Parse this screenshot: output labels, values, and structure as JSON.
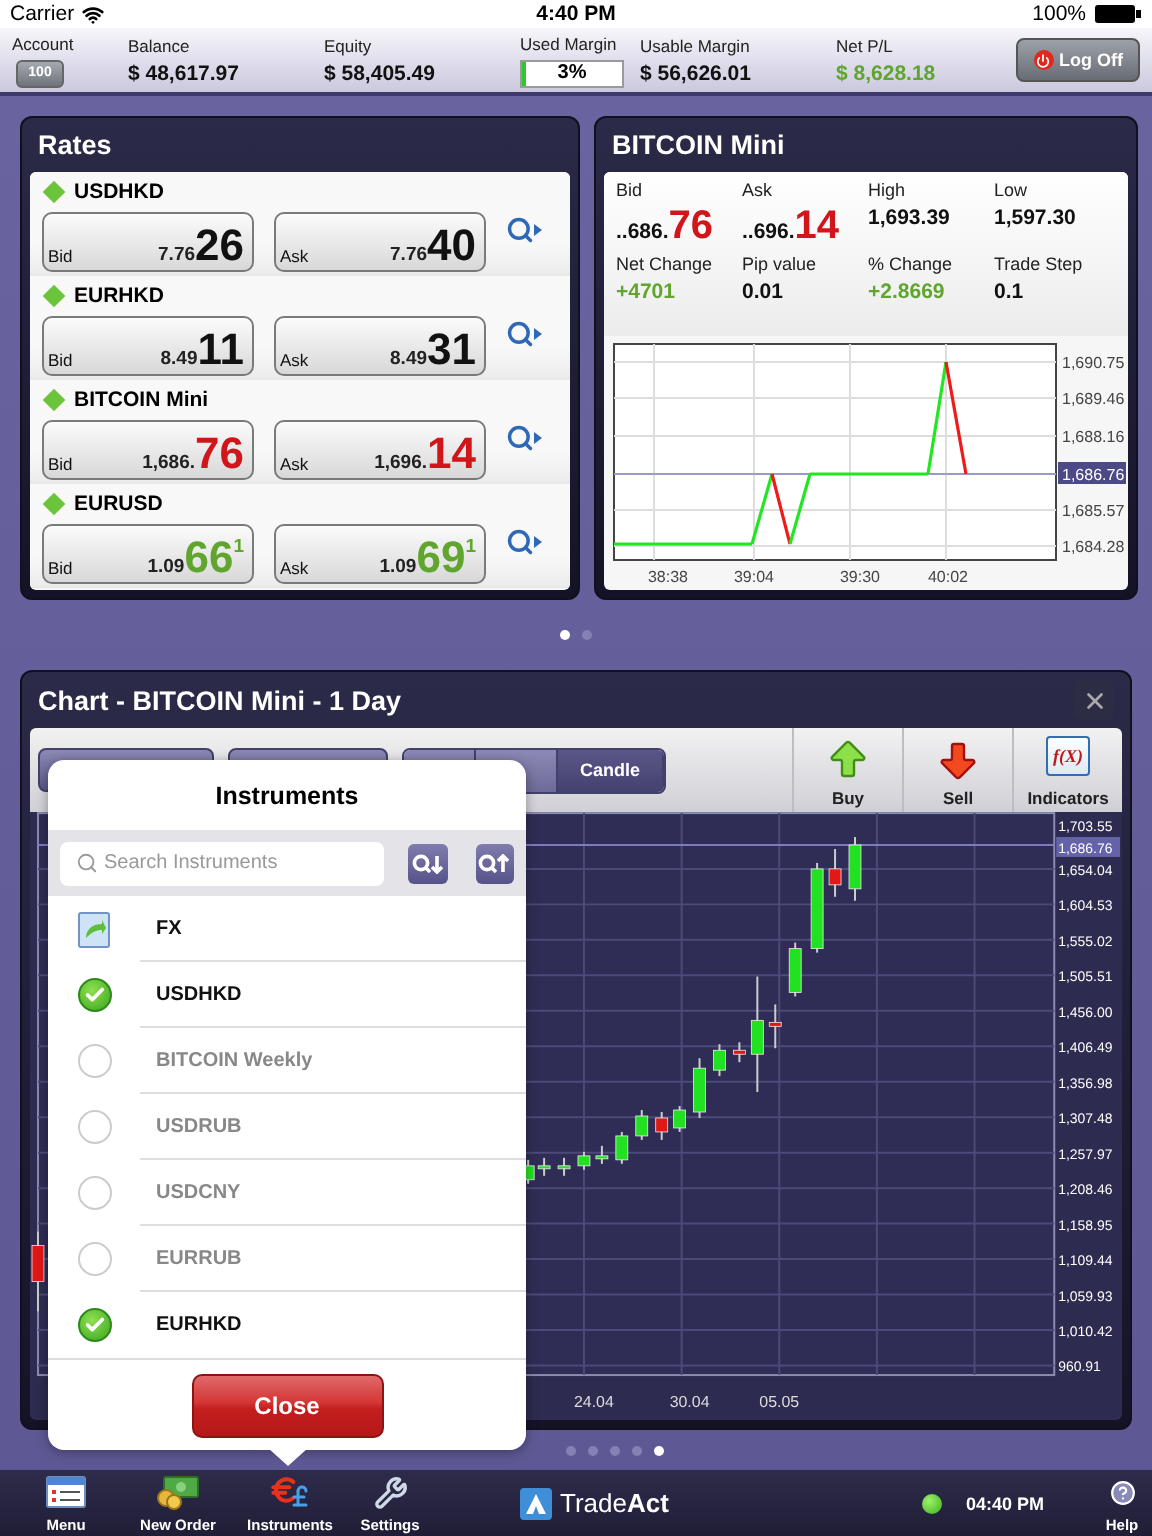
{
  "status_bar": {
    "carrier": "Carrier",
    "time": "4:40 PM",
    "battery": "100%"
  },
  "account_bar": {
    "account": {
      "label": "Account",
      "value": "100"
    },
    "fields": [
      {
        "label": "Balance",
        "value": "$ 48,617.97",
        "kind": "text",
        "color": "#111111"
      },
      {
        "label": "Equity",
        "value": "$ 58,405.49",
        "kind": "text",
        "color": "#111111"
      },
      {
        "label": "Used Margin",
        "value": "3%",
        "kind": "meter",
        "level": 0.03
      },
      {
        "label": "Usable Margin",
        "value": "$ 56,626.01",
        "kind": "text",
        "color": "#111111"
      },
      {
        "label": "Net P/L",
        "value": "$ 8,628.18",
        "kind": "text",
        "color": "#5fa52e"
      }
    ],
    "log_off": "Log Off"
  },
  "rates": {
    "title": "Rates",
    "rows": [
      {
        "name": "USDHKD",
        "quotes": [
          {
            "label": "Bid",
            "prefix": "7.76",
            "big": "26",
            "color": "#111111"
          },
          {
            "label": "Ask",
            "prefix": "7.76",
            "big": "40",
            "color": "#111111"
          }
        ]
      },
      {
        "name": "EURHKD",
        "quotes": [
          {
            "label": "Bid",
            "prefix": "8.49",
            "big": "11",
            "color": "#111111"
          },
          {
            "label": "Ask",
            "prefix": "8.49",
            "big": "31",
            "color": "#111111"
          }
        ]
      },
      {
        "name": "BITCOIN Mini",
        "quotes": [
          {
            "label": "Bid",
            "prefix": "1,686.",
            "big": "76",
            "color": "#d0161b"
          },
          {
            "label": "Ask",
            "prefix": "1,696.",
            "big": "14",
            "color": "#d0161b"
          }
        ]
      },
      {
        "name": "EURUSD",
        "quotes": [
          {
            "label": "Bid",
            "prefix": "1.09",
            "big": "66",
            "suffix": "1",
            "color": "#5fa52e"
          },
          {
            "label": "Ask",
            "prefix": "1.09",
            "big": "69",
            "suffix": "1",
            "color": "#5fa52e"
          }
        ]
      }
    ]
  },
  "details": {
    "title": "BITCOIN Mini",
    "stats": [
      {
        "label": "Bid",
        "value": "..686.",
        "big": "76",
        "color": "#d0161b"
      },
      {
        "label": "Ask",
        "value": "..696.",
        "big": "14",
        "color": "#d0161b"
      },
      {
        "label": "High",
        "value": "1,693.39",
        "color": "#111111"
      },
      {
        "label": "Low",
        "value": "1,597.30",
        "color": "#111111"
      },
      {
        "label": "Net Change",
        "value": "+4701",
        "color": "#5fa52e"
      },
      {
        "label": "Pip value",
        "value": "0.01",
        "color": "#111111"
      },
      {
        "label": "% Change",
        "value": "+2.8669",
        "color": "#5fa52e"
      },
      {
        "label": "Trade Step",
        "value": "0.1",
        "color": "#111111"
      }
    ],
    "tick_chart": {
      "y_labels": [
        {
          "text": "1,690.75",
          "current": false
        },
        {
          "text": "1,689.46",
          "current": false
        },
        {
          "text": "1,688.16",
          "current": false
        },
        {
          "text": "1,686.76",
          "current": true
        },
        {
          "text": "1,685.57",
          "current": false
        },
        {
          "text": "1,684.28",
          "current": false
        }
      ],
      "x_labels": [
        "38:38",
        "39:04",
        "39:30",
        "40:02"
      ]
    }
  },
  "top_pages": [
    {
      "selected": true
    },
    {
      "selected": false
    }
  ],
  "chart": {
    "title": "Chart - BITCOIN Mini - 1 Day",
    "chart_types": [
      {
        "label": "Candle",
        "selected": true
      }
    ],
    "actions": [
      {
        "label": "Buy",
        "kind": "buy"
      },
      {
        "label": "Sell",
        "kind": "sell"
      },
      {
        "label": "Indicators",
        "kind": "indicators",
        "glyph": "f(X)"
      }
    ],
    "y_labels": [
      {
        "text": "1,703.55",
        "current": false
      },
      {
        "text": "1,686.76",
        "current": true
      },
      {
        "text": "1,654.04",
        "current": false
      },
      {
        "text": "1,604.53",
        "current": false
      },
      {
        "text": "1,555.02",
        "current": false
      },
      {
        "text": "1,505.51",
        "current": false
      },
      {
        "text": "1,456.00",
        "current": false
      },
      {
        "text": "1,406.49",
        "current": false
      },
      {
        "text": "1,356.98",
        "current": false
      },
      {
        "text": "1,307.48",
        "current": false
      },
      {
        "text": "1,257.97",
        "current": false
      },
      {
        "text": "1,208.46",
        "current": false
      },
      {
        "text": "1,158.95",
        "current": false
      },
      {
        "text": "1,109.44",
        "current": false
      },
      {
        "text": "1,059.93",
        "current": false
      },
      {
        "text": "1,010.42",
        "current": false
      },
      {
        "text": "960.91",
        "current": false
      }
    ],
    "x_labels": [
      "24.04",
      "30.04",
      "05.05"
    ]
  },
  "bottom_pages": [
    {
      "selected": false
    },
    {
      "selected": false
    },
    {
      "selected": false
    },
    {
      "selected": false
    },
    {
      "selected": true
    }
  ],
  "popover": {
    "title": "Instruments",
    "search_placeholder": "Search Instruments",
    "group": "FX",
    "items": [
      {
        "name": "USDHKD",
        "checked": true
      },
      {
        "name": "BITCOIN Weekly",
        "checked": false
      },
      {
        "name": "USDRUB",
        "checked": false
      },
      {
        "name": "USDCNY",
        "checked": false
      },
      {
        "name": "EURRUB",
        "checked": false
      },
      {
        "name": "EURHKD",
        "checked": true
      }
    ],
    "close": "Close"
  },
  "toolbar": {
    "items": [
      {
        "label": "Menu",
        "kind": "menu"
      },
      {
        "label": "New Order",
        "kind": "order"
      },
      {
        "label": "Instruments",
        "kind": "instruments"
      },
      {
        "label": "Settings",
        "kind": "settings"
      }
    ],
    "brand": "Trade**Act**",
    "connected": true,
    "time": "04:40 PM",
    "help": "Help"
  }
}
